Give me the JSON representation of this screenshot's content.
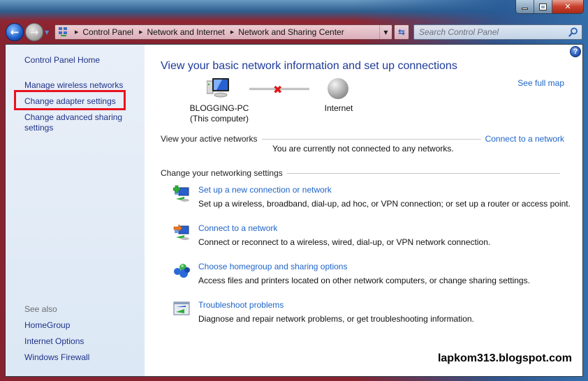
{
  "window": {
    "controls": {
      "minimize": "minimize",
      "maximize": "maximize",
      "close": "close"
    }
  },
  "nav": {
    "breadcrumbs": [
      "Control Panel",
      "Network and Internet",
      "Network and Sharing Center"
    ],
    "search_placeholder": "Search Control Panel"
  },
  "sidebar": {
    "home": "Control Panel Home",
    "links": [
      "Manage wireless networks",
      "Change adapter settings",
      "Change advanced sharing settings"
    ],
    "see_also_label": "See also",
    "see_also": [
      "HomeGroup",
      "Internet Options",
      "Windows Firewall"
    ],
    "highlighted_item": "Change adapter settings",
    "highlight_color": "#e8121e"
  },
  "main": {
    "title": "View your basic network information and set up connections",
    "see_full_map": "See full map",
    "map": {
      "computer_name": "BLOGGING-PC",
      "computer_sub": "(This computer)",
      "internet_label": "Internet",
      "status": "disconnected"
    },
    "active_networks": {
      "label": "View your active networks",
      "action": "Connect to a network",
      "message": "You are currently not connected to any networks."
    },
    "settings": {
      "label": "Change your networking settings",
      "tasks": [
        {
          "icon": "new-connection-icon",
          "title": "Set up a new connection or network",
          "desc": "Set up a wireless, broadband, dial-up, ad hoc, or VPN connection; or set up a router or access point."
        },
        {
          "icon": "connect-network-icon",
          "title": "Connect to a network",
          "desc": "Connect or reconnect to a wireless, wired, dial-up, or VPN network connection."
        },
        {
          "icon": "homegroup-icon",
          "title": "Choose homegroup and sharing options",
          "desc": "Access files and printers located on other network computers, or change sharing settings."
        },
        {
          "icon": "troubleshoot-icon",
          "title": "Troubleshoot problems",
          "desc": "Diagnose and repair network problems, or get troubleshooting information."
        }
      ]
    }
  },
  "watermark": "lapkom313.blogspot.com",
  "colors": {
    "link": "#1e64c8",
    "sidebar_link": "#1e3287",
    "title": "#1e3a9a"
  }
}
